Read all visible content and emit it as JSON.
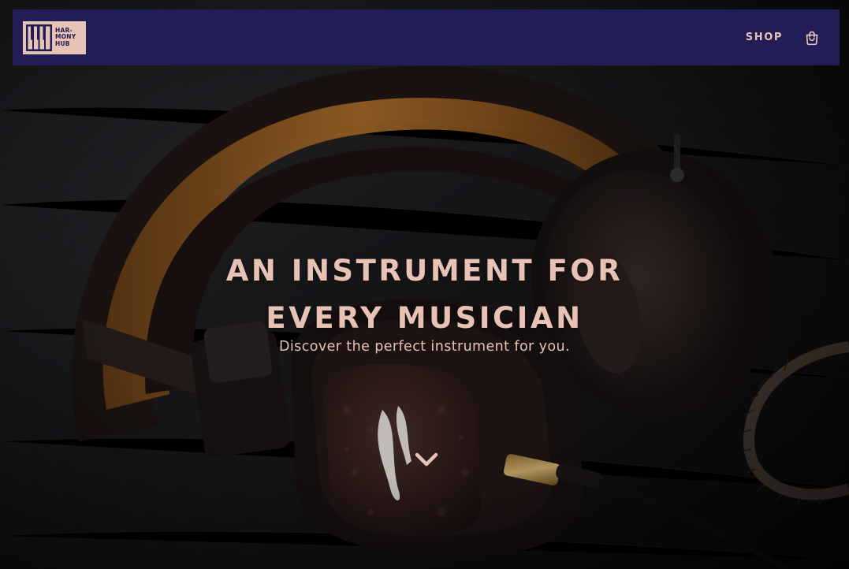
{
  "brand": {
    "logo_lines": [
      "HAR-",
      "MONY",
      "HUB"
    ],
    "colors": {
      "navy": "#201d57",
      "peach": "#e8c2b4"
    }
  },
  "nav": {
    "shop_label": "SHOP",
    "cart_icon": "shopping-bag-icon"
  },
  "hero": {
    "title_line1": "AN INSTRUMENT FOR",
    "title_line2": "EVERY MUSICIAN",
    "subtitle": "Discover the perfect instrument for you.",
    "scroll_icon": "chevron-down-icon",
    "background": "headphones-photo"
  }
}
